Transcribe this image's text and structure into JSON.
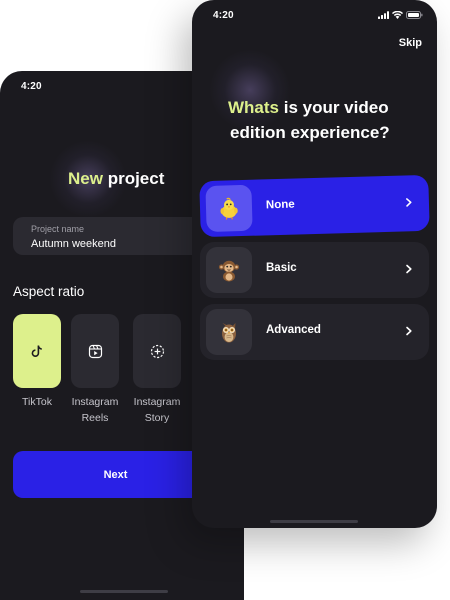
{
  "left_screen": {
    "status": {
      "time": "4:20"
    },
    "title": {
      "accent": "New",
      "rest": " project"
    },
    "project_name_field": {
      "label": "Project name",
      "value": "Autumn weekend"
    },
    "aspect_ratio": {
      "heading": "Aspect ratio",
      "options": [
        {
          "label": "TikTok",
          "icon": "tiktok-icon",
          "selected": true
        },
        {
          "label_line1": "Instagram",
          "label_line2": "Reels",
          "icon": "instagram-reels-icon",
          "selected": false
        },
        {
          "label_line1": "Instagram",
          "label_line2": "Story",
          "icon": "instagram-story-icon",
          "selected": false
        }
      ]
    },
    "next_button": {
      "label": "Next"
    }
  },
  "right_screen": {
    "status": {
      "time": "4:20"
    },
    "skip_label": "Skip",
    "question": {
      "accent": "Whats",
      "rest_line1": " is your video",
      "line2": "edition experience?"
    },
    "options": [
      {
        "label": "None",
        "icon": "chick-icon",
        "selected": true
      },
      {
        "label": "Basic",
        "icon": "monkey-icon",
        "selected": false
      },
      {
        "label": "Advanced",
        "icon": "owl-icon",
        "selected": false
      }
    ]
  },
  "colors": {
    "background": "#ffffff",
    "phone": "#1b1a1f",
    "surface": "#2b2a31",
    "accent_lime": "#ddf08c",
    "primary_blue": "#2a21e6"
  }
}
